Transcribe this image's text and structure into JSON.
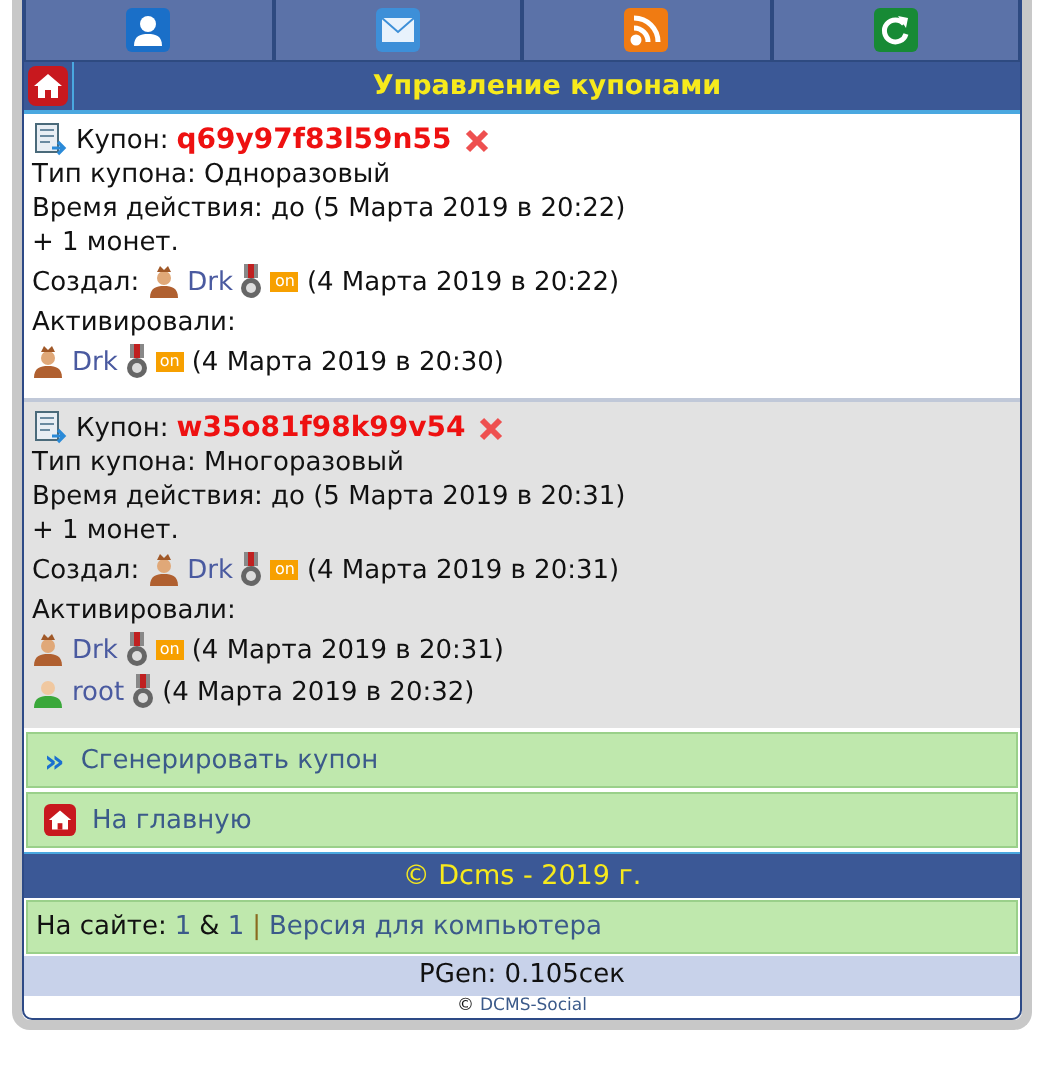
{
  "nav": [
    {
      "kind": "profile"
    },
    {
      "kind": "mail"
    },
    {
      "kind": "rss"
    },
    {
      "kind": "refresh"
    }
  ],
  "title": "Управление купонами",
  "coupons": [
    {
      "label": "Купон:",
      "code": "q69y97f83l59n55",
      "type": "Тип купона: Одноразовый",
      "validity": "Время действия: до (5 Марта 2019 в 20:22)",
      "reward": "+ 1 монет.",
      "creator_label": "Создал:",
      "creator": {
        "kind": "admin",
        "name": "Drk",
        "status": "on",
        "date": "(4 Марта 2019 в 20:22)"
      },
      "activated_label": "Активировали:",
      "activated": [
        {
          "kind": "admin",
          "name": "Drk",
          "status": "on",
          "date": "(4 Марта 2019 в 20:30)"
        }
      ]
    },
    {
      "label": "Купон:",
      "code": "w35o81f98k99v54",
      "type": "Тип купона: Многоразовый",
      "validity": "Время действия: до (5 Марта 2019 в 20:31)",
      "reward": "+ 1 монет.",
      "creator_label": "Создал:",
      "creator": {
        "kind": "admin",
        "name": "Drk",
        "status": "on",
        "date": "(4 Марта 2019 в 20:31)"
      },
      "activated_label": "Активировали:",
      "activated": [
        {
          "kind": "admin",
          "name": "Drk",
          "status": "on",
          "date": "(4 Марта 2019 в 20:31)"
        },
        {
          "kind": "user",
          "name": "root",
          "date": "(4 Марта 2019 в 20:32)"
        }
      ]
    }
  ],
  "links": [
    {
      "kind": "arrows",
      "icon_text": "»",
      "label": "Сгенерировать купон"
    },
    {
      "kind": "home",
      "label": "На главную"
    }
  ],
  "footer": "© Dcms - 2019 г.",
  "online": {
    "label": "На сайте:",
    "count_a": "1",
    "amp": "&",
    "count_b": "1",
    "sep": "|",
    "desktop_link": "Версия для компьютера"
  },
  "pgen": "PGen: 0.105сек",
  "copyright": {
    "sign": "©",
    "name": "DCMS-Social"
  }
}
